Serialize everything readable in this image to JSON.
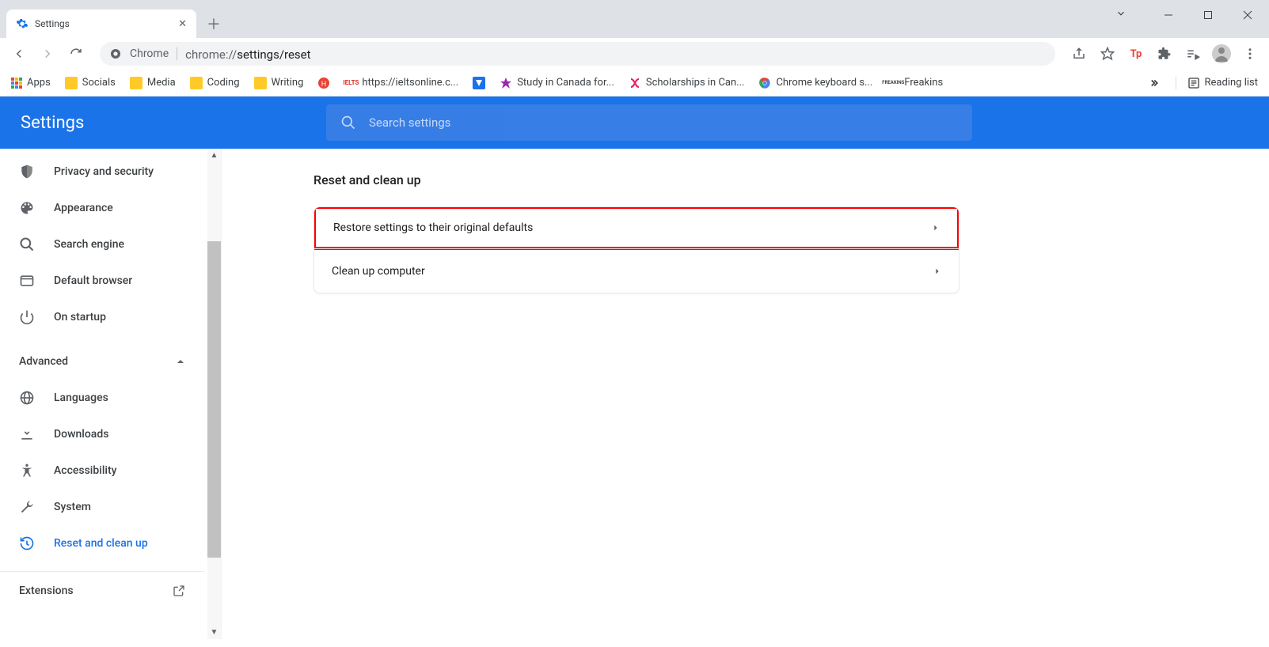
{
  "titlebar": {
    "tab_title": "Settings"
  },
  "toolbar": {
    "omnibox_chip": "Chrome",
    "omnibox_prefix": "chrome://",
    "omnibox_path": "settings/reset"
  },
  "bookmarks": {
    "apps": "Apps",
    "items": [
      {
        "label": "Socials",
        "kind": "folder"
      },
      {
        "label": "Media",
        "kind": "folder"
      },
      {
        "label": "Coding",
        "kind": "folder"
      },
      {
        "label": "Writing",
        "kind": "folder"
      },
      {
        "label": "",
        "kind": "icon"
      },
      {
        "label": "https://ieltsonline.c...",
        "kind": "link"
      },
      {
        "label": "",
        "kind": "icon"
      },
      {
        "label": "Study in Canada for...",
        "kind": "link"
      },
      {
        "label": "Scholarships in Can...",
        "kind": "link"
      },
      {
        "label": "Chrome keyboard s...",
        "kind": "link"
      },
      {
        "label": "Freakins",
        "kind": "link"
      }
    ],
    "reading_list": "Reading list"
  },
  "header": {
    "title": "Settings",
    "search_placeholder": "Search settings"
  },
  "sidebar": {
    "basic": [
      {
        "icon": "shield",
        "label": "Privacy and security"
      },
      {
        "icon": "palette",
        "label": "Appearance"
      },
      {
        "icon": "search",
        "label": "Search engine"
      },
      {
        "icon": "browser",
        "label": "Default browser"
      },
      {
        "icon": "power",
        "label": "On startup"
      }
    ],
    "advanced_label": "Advanced",
    "advanced": [
      {
        "icon": "globe",
        "label": "Languages"
      },
      {
        "icon": "download",
        "label": "Downloads"
      },
      {
        "icon": "accessibility",
        "label": "Accessibility"
      },
      {
        "icon": "wrench",
        "label": "System"
      },
      {
        "icon": "restore",
        "label": "Reset and clean up"
      }
    ],
    "extensions": "Extensions"
  },
  "main": {
    "section_title": "Reset and clean up",
    "rows": [
      {
        "label": "Restore settings to their original defaults",
        "highlighted": true
      },
      {
        "label": "Clean up computer",
        "highlighted": false
      }
    ]
  }
}
